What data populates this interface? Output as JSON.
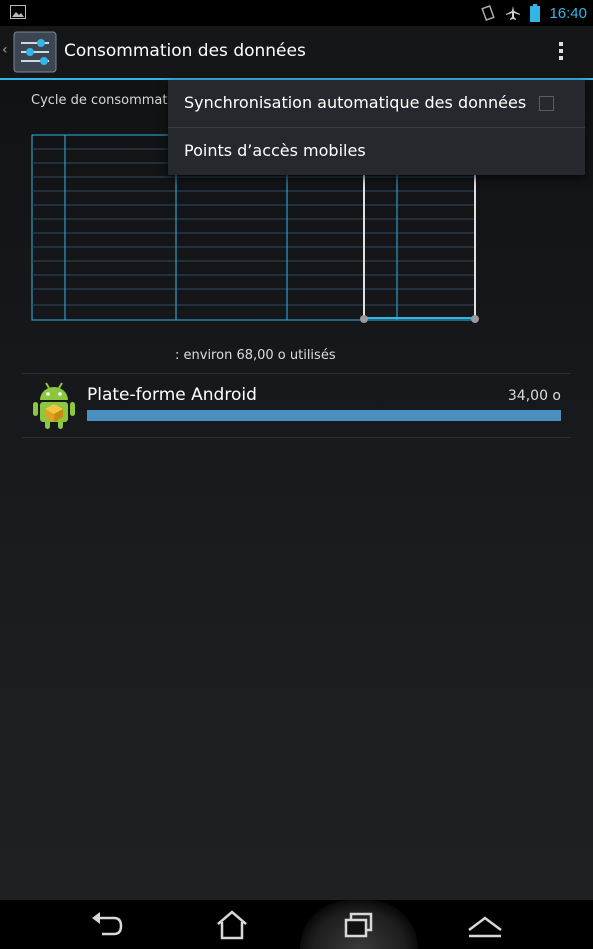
{
  "status_bar": {
    "time": "16:40",
    "icons": [
      "image-notification-icon",
      "vibrate-icon",
      "airplane-mode-icon",
      "battery-icon"
    ]
  },
  "action_bar": {
    "title": "Consommation des données",
    "icons": [
      "up-chevron-icon",
      "data-usage-settings-icon",
      "overflow-menu-icon"
    ]
  },
  "content": {
    "cycle_label": "Cycle de consommati",
    "usage_summary": ": environ 68,00 o utilisés",
    "apps": [
      {
        "name": "Plate-forme Android",
        "size": "34,00 o",
        "usage_fraction": 1.0,
        "icon": "android-platform-icon"
      }
    ]
  },
  "menu": {
    "items": [
      {
        "label": "Synchronisation automatique des données",
        "checked": false
      },
      {
        "label": "Points d’accès mobiles"
      }
    ]
  },
  "navigation_bar": {
    "icons": [
      "back-icon",
      "home-icon",
      "recent-apps-icon",
      "menu-chevron-icon"
    ]
  },
  "colors": {
    "accent": "#33b5e5",
    "usage_bar": "#4a8fc0"
  }
}
